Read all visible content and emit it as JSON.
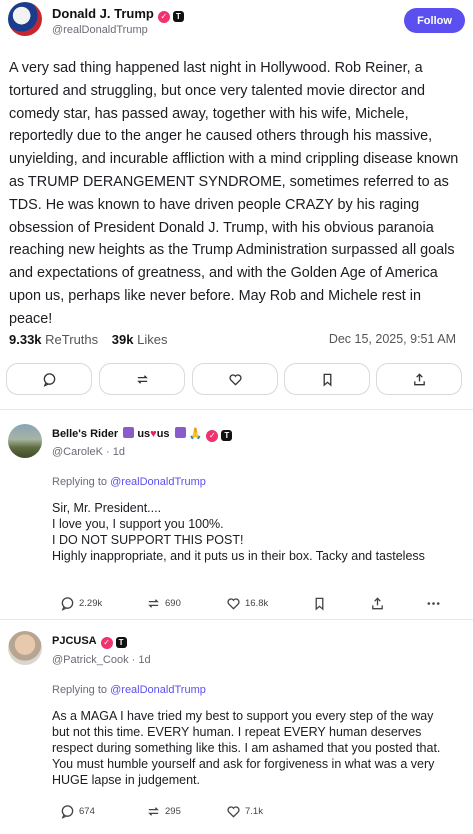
{
  "post": {
    "author_name": "Donald J. Trump",
    "author_handle": "@realDonaldTrump",
    "follow_label": "Follow",
    "text": "A very sad thing happened last night in Hollywood. Rob Reiner, a tortured and struggling, but once very talented movie director and comedy star, has passed away, together with his wife, Michele, reportedly due to the anger he caused others through his massive, unyielding, and incurable affliction with a mind crippling disease known as TRUMP DERANGEMENT SYNDROME, sometimes referred to as TDS. He was known to have driven people CRAZY by his raging obsession of President Donald J. Trump, with his obvious paranoia reaching new heights as the Trump Administration surpassed all goals and expectations of greatness, and with the Golden Age of America upon us, perhaps like never before. May Rob and Michele rest in peace!",
    "retruths_count": "9.33k",
    "retruths_label": "ReTruths",
    "likes_count": "39k",
    "likes_label": "Likes",
    "date": "Dec 15, 2025, 9:51 AM"
  },
  "replies": [
    {
      "name": "Belle's Rider",
      "name_emoji_text_1": "us",
      "name_emoji_text_2": "us",
      "handle": "@CaroleK",
      "age": "1d",
      "replying_prefix": "Replying to",
      "replying_to": "@realDonaldTrump",
      "text_lines": [
        "Sir, Mr. President....",
        "I love you, I support you 100%.",
        "I DO NOT SUPPORT THIS POST!",
        "Highly inappropriate, and it puts us in their box. Tacky and tasteless"
      ],
      "reply_count": "2.29k",
      "retruth_count": "690",
      "like_count": "16.8k"
    },
    {
      "name": "PJCUSA",
      "handle": "@Patrick_Cook",
      "age": "1d",
      "replying_prefix": "Replying to",
      "replying_to": "@realDonaldTrump",
      "text": "As a MAGA I have tried my best to support you every step of the way but not this time.  EVERY human.  I repeat EVERY human deserves respect during something like this.  I am ashamed that you posted that. You must humble yourself and ask for forgiveness in what was a very HUGE lapse in judgement.",
      "reply_count": "674",
      "retruth_count": "295",
      "like_count": "7.1k"
    }
  ],
  "icons": {
    "reply": "speech-bubble-icon",
    "retruth": "retruth-arrows-icon",
    "like": "heart-icon",
    "bookmark": "bookmark-icon",
    "share": "share-upload-icon",
    "more": "more-dots-icon"
  },
  "colors": {
    "accent": "#5b4ff0",
    "verified": "#f0326e",
    "border": "#d8d8df"
  }
}
